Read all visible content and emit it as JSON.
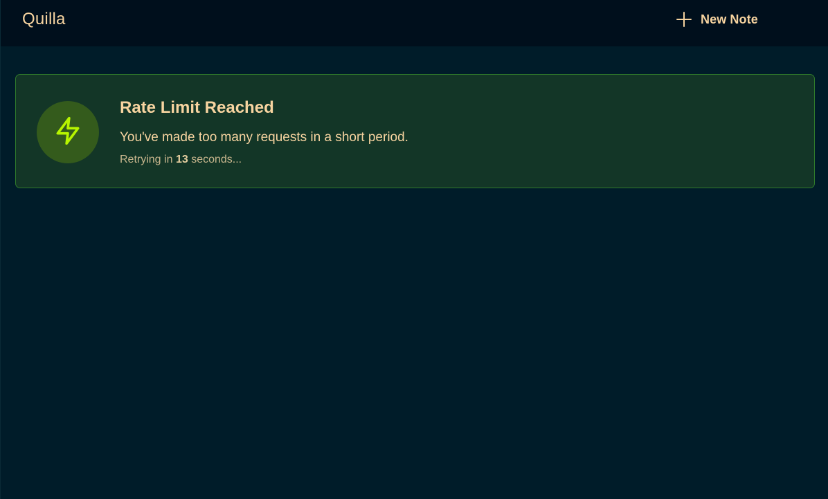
{
  "header": {
    "app_title": "Quilla",
    "new_note_label": "New Note",
    "new_note_icon": "plus-icon"
  },
  "alert": {
    "icon": "lightning-bolt-icon",
    "title": "Rate Limit Reached",
    "message": "You've made too many requests in a short period.",
    "retry_prefix": "Retrying in",
    "retry_seconds": "13",
    "retry_suffix": "seconds..."
  },
  "colors": {
    "background": "#001c29",
    "topbar": "#000f1c",
    "accent_text": "#f7d4a0",
    "alert_background": "#133627",
    "alert_border": "#2f7a2b",
    "icon_circle": "#345b1c",
    "icon_stroke": "#b7f500"
  }
}
